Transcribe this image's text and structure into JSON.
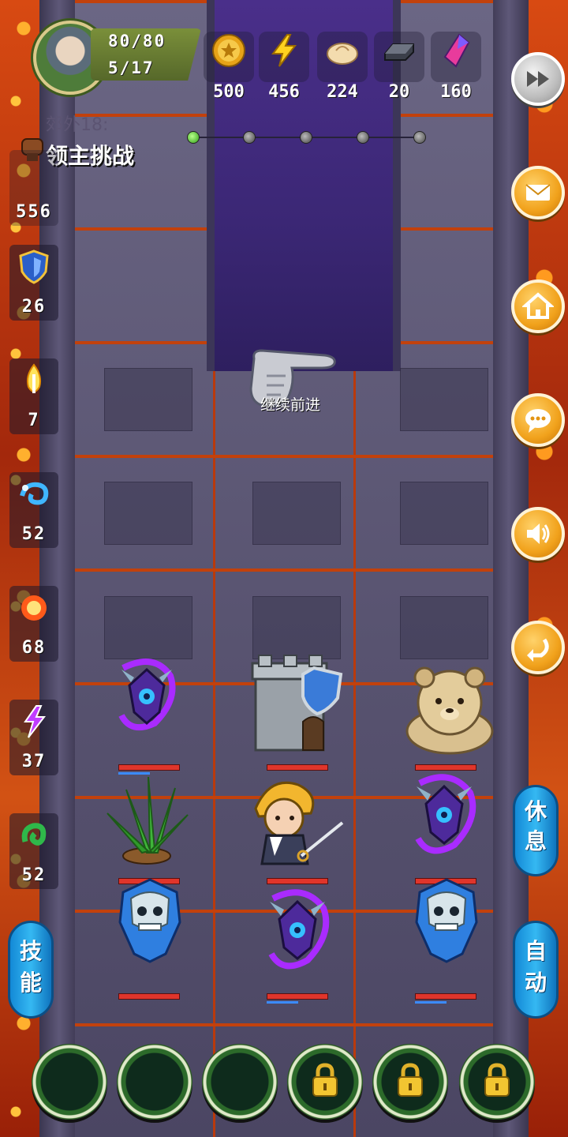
{
  "player": {
    "hp": "80/80",
    "stage_progress": "5/17"
  },
  "resources": [
    {
      "name": "gold",
      "icon": "gold-coin-icon",
      "value": "500"
    },
    {
      "name": "energy",
      "icon": "lightning-icon",
      "value": "456"
    },
    {
      "name": "bun",
      "icon": "bun-icon",
      "value": "224"
    },
    {
      "name": "iron",
      "icon": "iron-ingot-icon",
      "value": "20"
    },
    {
      "name": "crystal",
      "icon": "crystal-icon",
      "value": "160"
    }
  ],
  "location": {
    "area": "郊外18:",
    "title": "领主挑战"
  },
  "stats": [
    {
      "icon": "fist-icon",
      "value": "556"
    },
    {
      "icon": "shield-icon",
      "value": "26"
    },
    {
      "icon": "sword-flame-icon",
      "value": "7"
    },
    {
      "icon": "water-swirl-icon",
      "value": "52"
    },
    {
      "icon": "fire-orb-icon",
      "value": "68"
    },
    {
      "icon": "lightning-purple-icon",
      "value": "37"
    },
    {
      "icon": "poison-icon",
      "value": "52"
    }
  ],
  "side_buttons": [
    "fast-forward-icon",
    "mail-icon",
    "home-icon",
    "chat-icon",
    "sound-icon",
    "back-icon"
  ],
  "hint": {
    "text": "继续前进"
  },
  "actions": {
    "rest": "休息",
    "auto": "自动",
    "skill": "技能"
  },
  "progress_nodes": 5,
  "skill_slots": [
    "empty",
    "empty",
    "empty",
    "locked",
    "locked",
    "locked"
  ]
}
